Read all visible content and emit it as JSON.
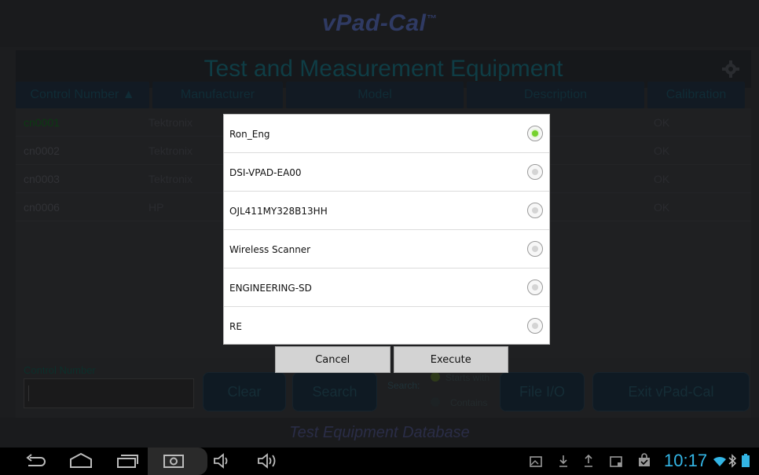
{
  "app": {
    "brand": "vPad-Cal",
    "brand_mark": "™"
  },
  "panel": {
    "title": "Test and Measurement Equipment"
  },
  "table": {
    "headers": [
      "Control Number ▲",
      "Manufacturer",
      "Model",
      "Description",
      "Calibration"
    ],
    "rows": [
      {
        "control": "cn0001",
        "manufacturer": "Tektronix",
        "calibration": "OK"
      },
      {
        "control": "cn0002",
        "manufacturer": "Tektronix",
        "calibration": "OK"
      },
      {
        "control": "cn0003",
        "manufacturer": "Tektronix",
        "calibration": "OK"
      },
      {
        "control": "cn0006",
        "manufacturer": "HP",
        "calibration": "OK"
      }
    ]
  },
  "bottom": {
    "control_number_label": "Control Number",
    "control_number_value": "",
    "clear": "Clear",
    "search": "Search",
    "search_label": "Search:",
    "starts_with": "Starts with",
    "contains": "Contains",
    "file_io": "File I/O",
    "exit": "Exit vPad-Cal"
  },
  "footer": {
    "text": "Test Equipment Database"
  },
  "dialog": {
    "options": [
      {
        "label": "Ron_Eng",
        "selected": true
      },
      {
        "label": "DSI-VPAD-EA00",
        "selected": false
      },
      {
        "label": "OJL411MY328B13HH",
        "selected": false
      },
      {
        "label": "Wireless Scanner",
        "selected": false
      },
      {
        "label": "ENGINEERING-SD",
        "selected": false
      },
      {
        "label": "RE",
        "selected": false
      }
    ],
    "cancel": "Cancel",
    "execute": "Execute"
  },
  "status": {
    "time": "10:17"
  },
  "colors": {
    "accent": "#33b5e5",
    "radio_selected": "#76d12e"
  }
}
